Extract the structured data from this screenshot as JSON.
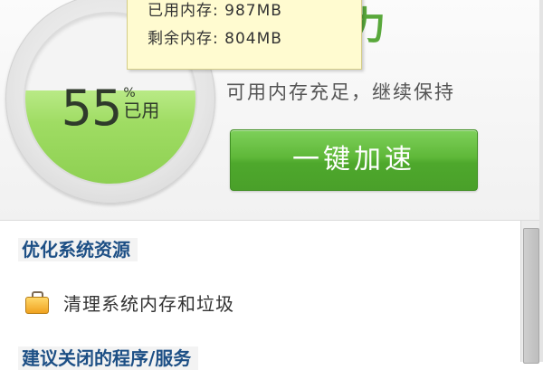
{
  "gauge": {
    "percent": 55,
    "value": "55",
    "percent_sign": "%",
    "used_label": "已用",
    "fill_color": "#9fdc63"
  },
  "headline": "满活力",
  "subtitle": "可用内存充足，继续保持",
  "tooltip": {
    "used_memory": "已用内存: 987MB",
    "free_memory": "剩余内存: 804MB"
  },
  "speed_button": {
    "label": "一键加速"
  },
  "sections": {
    "optimize_title": "优化系统资源",
    "clean_item": "清理系统内存和垃圾",
    "suggest_title": "建议关闭的程序/服务"
  },
  "icons": {
    "clean": "briefcase-icon"
  },
  "colors": {
    "accent_green": "#59a83b",
    "button_green": "#5fb839",
    "section_blue": "#1d4f85"
  }
}
